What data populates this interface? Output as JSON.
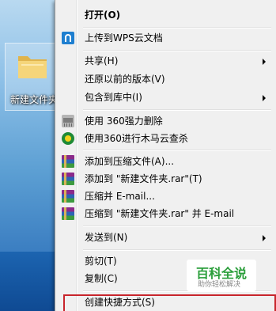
{
  "desktop": {
    "folder_label": "新建文件夹"
  },
  "menu": {
    "items": [
      {
        "label": "打开(O)"
      },
      {
        "label": "上传到WPS云文档"
      },
      {
        "label": "共享(H)"
      },
      {
        "label": "还原以前的版本(V)"
      },
      {
        "label": "包含到库中(I)"
      },
      {
        "label": "使用 360强力删除"
      },
      {
        "label": "使用360进行木马云查杀"
      },
      {
        "label": "添加到压缩文件(A)..."
      },
      {
        "label": "添加到 \"新建文件夹.rar\"(T)"
      },
      {
        "label": "压缩并 E-mail..."
      },
      {
        "label": "压缩到 \"新建文件夹.rar\" 并 E-mail"
      },
      {
        "label": "发送到(N)"
      },
      {
        "label": "剪切(T)"
      },
      {
        "label": "复制(C)"
      },
      {
        "label": "创建快捷方式(S)"
      }
    ]
  },
  "watermark": {
    "title": "百科全说",
    "subtitle": "助你轻松解决"
  },
  "colors": {
    "menu_bg": "#f0f0f0",
    "highlight_border": "#c8252c",
    "watermark_green": "#2a9e3a"
  }
}
